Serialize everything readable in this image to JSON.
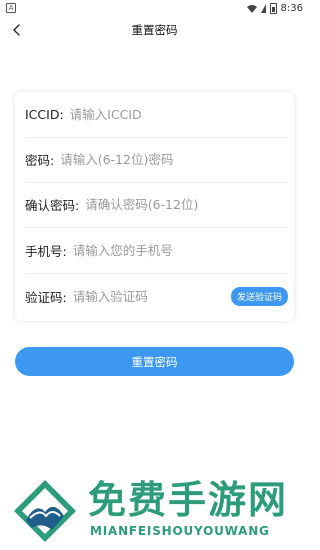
{
  "status_bar": {
    "left_icon": "A",
    "time": "8:36"
  },
  "nav": {
    "back_icon": "chevron-left-icon",
    "title": "重置密码"
  },
  "form": {
    "fields": [
      {
        "label": "ICCID:",
        "placeholder": "请输入ICCID",
        "value": ""
      },
      {
        "label": "密码:",
        "placeholder": "请输入(6-12位)密码",
        "value": ""
      },
      {
        "label": "确认密码:",
        "placeholder": "请确认密码(6-12位)",
        "value": ""
      },
      {
        "label": "手机号:",
        "placeholder": "请输入您的手机号",
        "value": ""
      },
      {
        "label": "验证码:",
        "placeholder": "请输入验证码",
        "value": ""
      }
    ],
    "send_code_label": "发送验证码"
  },
  "submit_label": "重置密码",
  "watermark": {
    "title": "免费手游网",
    "subtitle": "MIANFEISHOUYOUWANG"
  },
  "colors": {
    "accent": "#3d98f2",
    "watermark": "#2c9c7a"
  }
}
